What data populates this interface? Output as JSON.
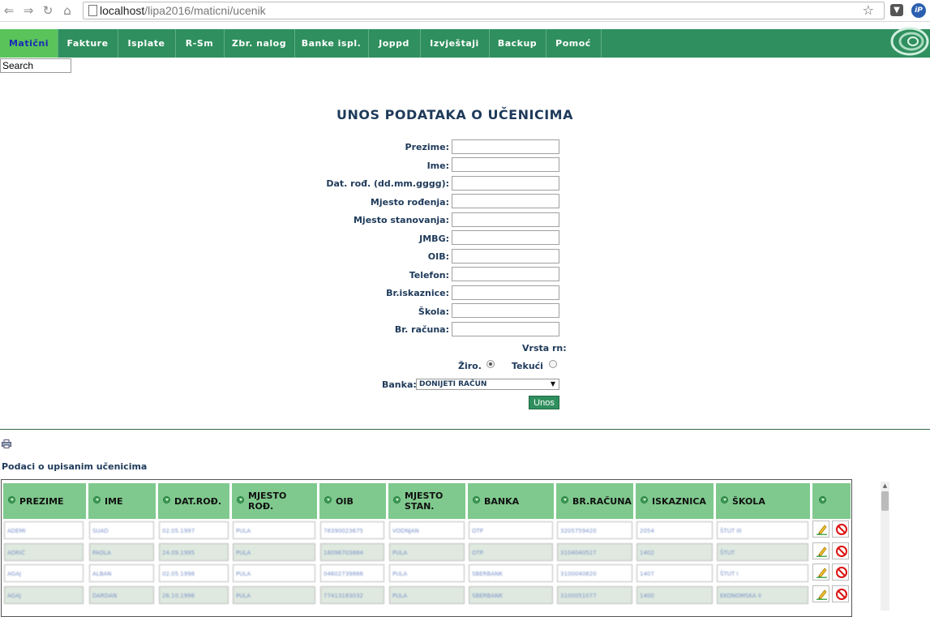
{
  "browser": {
    "url_host": "localhost",
    "url_path": "/lipa2016/maticni/ucenik",
    "ext2_label": "iP"
  },
  "menu": {
    "items": [
      "Matični",
      "Fakture",
      "Isplate",
      "R-Sm",
      "Zbr. nalog",
      "Banke ispl.",
      "Joppd",
      "Izvještaji",
      "Backup",
      "Pomoć"
    ]
  },
  "search": {
    "value": "Search"
  },
  "form": {
    "title": "UNOS PODATAKA O UČENICIMA",
    "fields": [
      {
        "label": "Prezime:"
      },
      {
        "label": "Ime:"
      },
      {
        "label": "Dat. rođ. (dd.mm.gggg):"
      },
      {
        "label": "Mjesto rođenja:"
      },
      {
        "label": "Mjesto stanovanja:"
      },
      {
        "label": "JMBG:"
      },
      {
        "label": "OIB:"
      },
      {
        "label": "Telefon:"
      },
      {
        "label": "Br.iskaznice:"
      },
      {
        "label": "Škola:"
      },
      {
        "label": "Br. računa:"
      }
    ],
    "vrsta_label": "Vrsta rn:",
    "radio_ziro": "Žiro.",
    "radio_tekuci": "Tekući",
    "selected_radio": "Žiro.",
    "banka_label": "Banka:",
    "banka_selected": "DONIJETI RAČUN",
    "submit_label": "Unos"
  },
  "table": {
    "title": "Podaci o upisanim učenicima",
    "headers": [
      "PREZIME",
      "IME",
      "DAT.ROĐ.",
      "MJESTO ROĐ.",
      "OIB",
      "MJESTO STAN.",
      "BANKA",
      "BR.RAČUNA",
      "ISKAZNICA",
      "ŠKOLA",
      ""
    ],
    "rows": [
      [
        "ADEMI",
        "SUAD",
        "02.05.1997",
        "PULA",
        "78390023675",
        "VODNJAN",
        "OTP",
        "3205759420",
        "2054",
        "ŠTUT III"
      ],
      [
        "ADRIĆ",
        "PAOLA",
        "24.09.1995",
        "PULA",
        "16096703884",
        "PULA",
        "OTP",
        "3104040527",
        "1402",
        "ŠTUT"
      ],
      [
        "AGAJ",
        "ALBAN",
        "02.05.1998",
        "PULA",
        "04602739866",
        "PULA",
        "SBERBANK",
        "3100040820",
        "1407",
        "ŠTUT I"
      ],
      [
        "AGAJ",
        "DARDAN",
        "26.10.1996",
        "PULA",
        "77413183032",
        "PULA",
        "SBERBANK",
        "3100051077",
        "1400",
        "EKONOMSKA II"
      ]
    ]
  }
}
